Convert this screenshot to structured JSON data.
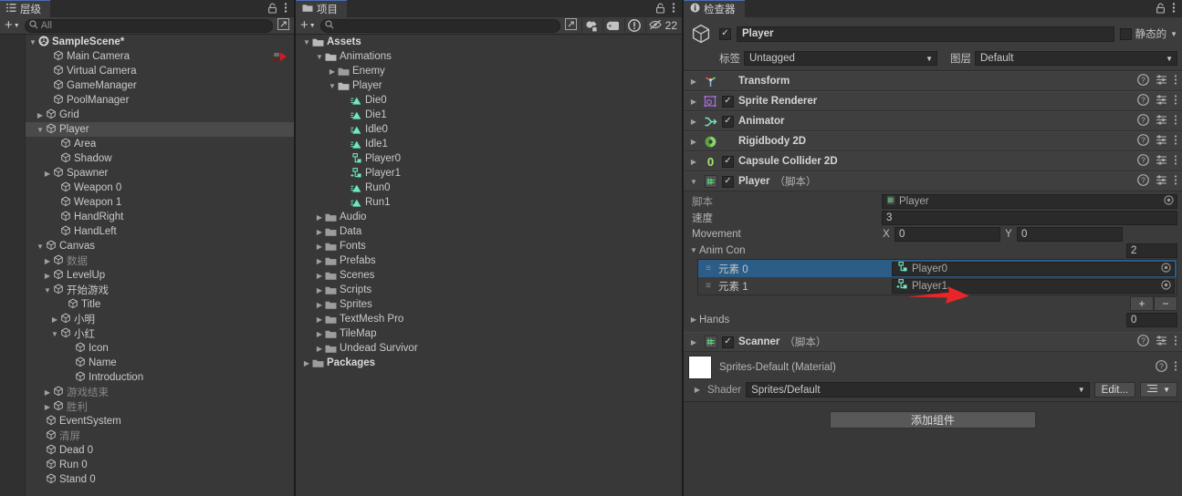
{
  "hierarchy": {
    "tab_label": "层级",
    "lock_icon": "lock-icon",
    "menu_icon": "kebab-menu-icon",
    "add_label": "+",
    "search_placeholder": "All",
    "items": [
      {
        "label": "SampleScene*",
        "depth": 0,
        "arrow": "down",
        "icon": "unity-scene-icon",
        "bold": true,
        "dim": false,
        "selected": false,
        "badge": "camera-preview-icon"
      },
      {
        "label": "Main Camera",
        "depth": 2,
        "arrow": "none",
        "icon": "gameobject-icon",
        "bold": false,
        "dim": false,
        "selected": false,
        "badge": "camera-preview-icon"
      },
      {
        "label": "Virtual Camera",
        "depth": 2,
        "arrow": "none",
        "icon": "gameobject-icon",
        "bold": false,
        "dim": false,
        "selected": false
      },
      {
        "label": "GameManager",
        "depth": 2,
        "arrow": "none",
        "icon": "gameobject-icon",
        "bold": false,
        "dim": false,
        "selected": false
      },
      {
        "label": "PoolManager",
        "depth": 2,
        "arrow": "none",
        "icon": "gameobject-icon",
        "bold": false,
        "dim": false,
        "selected": false
      },
      {
        "label": "Grid",
        "depth": 1,
        "arrow": "right",
        "icon": "gameobject-icon",
        "bold": false,
        "dim": false,
        "selected": false
      },
      {
        "label": "Player",
        "depth": 1,
        "arrow": "down",
        "icon": "gameobject-icon",
        "bold": false,
        "dim": false,
        "selected": true
      },
      {
        "label": "Area",
        "depth": 3,
        "arrow": "none",
        "icon": "gameobject-icon",
        "bold": false,
        "dim": false,
        "selected": false
      },
      {
        "label": "Shadow",
        "depth": 3,
        "arrow": "none",
        "icon": "gameobject-icon",
        "bold": false,
        "dim": false,
        "selected": false
      },
      {
        "label": "Spawner",
        "depth": 2,
        "arrow": "right",
        "icon": "gameobject-icon",
        "bold": false,
        "dim": false,
        "selected": false
      },
      {
        "label": "Weapon 0",
        "depth": 3,
        "arrow": "none",
        "icon": "gameobject-icon",
        "bold": false,
        "dim": false,
        "selected": false
      },
      {
        "label": "Weapon 1",
        "depth": 3,
        "arrow": "none",
        "icon": "gameobject-icon",
        "bold": false,
        "dim": false,
        "selected": false
      },
      {
        "label": "HandRight",
        "depth": 3,
        "arrow": "none",
        "icon": "gameobject-icon",
        "bold": false,
        "dim": false,
        "selected": false
      },
      {
        "label": "HandLeft",
        "depth": 3,
        "arrow": "none",
        "icon": "gameobject-icon",
        "bold": false,
        "dim": false,
        "selected": false
      },
      {
        "label": "Canvas",
        "depth": 1,
        "arrow": "down",
        "icon": "gameobject-icon",
        "bold": false,
        "dim": false,
        "selected": false
      },
      {
        "label": "数据",
        "depth": 2,
        "arrow": "right",
        "icon": "gameobject-icon",
        "bold": false,
        "dim": true,
        "selected": false
      },
      {
        "label": "LevelUp",
        "depth": 2,
        "arrow": "right",
        "icon": "gameobject-icon",
        "bold": false,
        "dim": false,
        "selected": false
      },
      {
        "label": "开始游戏",
        "depth": 2,
        "arrow": "down",
        "icon": "gameobject-icon",
        "bold": false,
        "dim": false,
        "selected": false
      },
      {
        "label": "Title",
        "depth": 4,
        "arrow": "none",
        "icon": "gameobject-icon",
        "bold": false,
        "dim": false,
        "selected": false
      },
      {
        "label": "小明",
        "depth": 3,
        "arrow": "right",
        "icon": "gameobject-icon",
        "bold": false,
        "dim": false,
        "selected": false
      },
      {
        "label": "小红",
        "depth": 3,
        "arrow": "down",
        "icon": "gameobject-icon",
        "bold": false,
        "dim": false,
        "selected": false
      },
      {
        "label": "Icon",
        "depth": 5,
        "arrow": "none",
        "icon": "gameobject-icon",
        "bold": false,
        "dim": false,
        "selected": false
      },
      {
        "label": "Name",
        "depth": 5,
        "arrow": "none",
        "icon": "gameobject-icon",
        "bold": false,
        "dim": false,
        "selected": false
      },
      {
        "label": "Introduction",
        "depth": 5,
        "arrow": "none",
        "icon": "gameobject-icon",
        "bold": false,
        "dim": false,
        "selected": false
      },
      {
        "label": "游戏结束",
        "depth": 2,
        "arrow": "right",
        "icon": "gameobject-icon",
        "bold": false,
        "dim": true,
        "selected": false
      },
      {
        "label": "胜利",
        "depth": 2,
        "arrow": "right",
        "icon": "gameobject-icon",
        "bold": false,
        "dim": true,
        "selected": false
      },
      {
        "label": "EventSystem",
        "depth": 1,
        "arrow": "none",
        "icon": "gameobject-icon",
        "bold": false,
        "dim": false,
        "selected": false
      },
      {
        "label": "清屏",
        "depth": 1,
        "arrow": "none",
        "icon": "gameobject-icon",
        "bold": false,
        "dim": true,
        "selected": false
      },
      {
        "label": "Dead 0",
        "depth": 1,
        "arrow": "none",
        "icon": "gameobject-icon",
        "bold": false,
        "dim": false,
        "selected": false
      },
      {
        "label": "Run 0",
        "depth": 1,
        "arrow": "none",
        "icon": "gameobject-icon",
        "bold": false,
        "dim": false,
        "selected": false
      },
      {
        "label": "Stand 0",
        "depth": 1,
        "arrow": "none",
        "icon": "gameobject-icon",
        "bold": false,
        "dim": false,
        "selected": false
      }
    ]
  },
  "project": {
    "tab_label": "项目",
    "tab_icon": "folder-icon",
    "lock_icon": "lock-icon",
    "menu_icon": "kebab-menu-icon",
    "add_label": "+",
    "search_placeholder": "",
    "toolbar_icons": [
      {
        "name": "search-by-type-icon"
      },
      {
        "name": "search-by-label-icon"
      },
      {
        "name": "warning-icon"
      }
    ],
    "hidden_count": "22",
    "hidden_icon": "eye-off-icon",
    "items": [
      {
        "label": "Assets",
        "depth": 0,
        "arrow": "down",
        "icon": "folder-open-icon",
        "bold": true
      },
      {
        "label": "Animations",
        "depth": 1,
        "arrow": "down",
        "icon": "folder-open-icon",
        "bold": false
      },
      {
        "label": "Enemy",
        "depth": 2,
        "arrow": "right",
        "icon": "folder-icon",
        "bold": false
      },
      {
        "label": "Player",
        "depth": 2,
        "arrow": "down",
        "icon": "folder-open-icon",
        "bold": false
      },
      {
        "label": "Die0",
        "depth": 3,
        "arrow": "none",
        "icon": "animation-clip-icon",
        "bold": false
      },
      {
        "label": "Die1",
        "depth": 3,
        "arrow": "none",
        "icon": "animation-clip-icon",
        "bold": false
      },
      {
        "label": "Idle0",
        "depth": 3,
        "arrow": "none",
        "icon": "animation-clip-icon",
        "bold": false
      },
      {
        "label": "Idle1",
        "depth": 3,
        "arrow": "none",
        "icon": "animation-clip-icon",
        "bold": false
      },
      {
        "label": "Player0",
        "depth": 3,
        "arrow": "none",
        "icon": "animator-controller-icon",
        "bold": false
      },
      {
        "label": "Player1",
        "depth": 3,
        "arrow": "none",
        "icon": "animator-override-icon",
        "bold": false
      },
      {
        "label": "Run0",
        "depth": 3,
        "arrow": "none",
        "icon": "animation-clip-icon",
        "bold": false
      },
      {
        "label": "Run1",
        "depth": 3,
        "arrow": "none",
        "icon": "animation-clip-icon",
        "bold": false
      },
      {
        "label": "Audio",
        "depth": 1,
        "arrow": "right",
        "icon": "folder-icon",
        "bold": false
      },
      {
        "label": "Data",
        "depth": 1,
        "arrow": "right",
        "icon": "folder-icon",
        "bold": false
      },
      {
        "label": "Fonts",
        "depth": 1,
        "arrow": "right",
        "icon": "folder-icon",
        "bold": false
      },
      {
        "label": "Prefabs",
        "depth": 1,
        "arrow": "right",
        "icon": "folder-icon",
        "bold": false
      },
      {
        "label": "Scenes",
        "depth": 1,
        "arrow": "right",
        "icon": "folder-icon",
        "bold": false
      },
      {
        "label": "Scripts",
        "depth": 1,
        "arrow": "right",
        "icon": "folder-icon",
        "bold": false
      },
      {
        "label": "Sprites",
        "depth": 1,
        "arrow": "right",
        "icon": "folder-icon",
        "bold": false
      },
      {
        "label": "TextMesh Pro",
        "depth": 1,
        "arrow": "right",
        "icon": "folder-icon",
        "bold": false
      },
      {
        "label": "TileMap",
        "depth": 1,
        "arrow": "right",
        "icon": "folder-icon",
        "bold": false
      },
      {
        "label": "Undead Survivor",
        "depth": 1,
        "arrow": "right",
        "icon": "folder-icon",
        "bold": false
      },
      {
        "label": "Packages",
        "depth": 0,
        "arrow": "right",
        "icon": "folder-icon",
        "bold": true
      }
    ]
  },
  "inspector": {
    "tab_label": "检查器",
    "tab_icon": "info-icon",
    "lock_icon": "lock-icon",
    "menu_icon": "kebab-menu-icon",
    "object_icon": "gameobject-icon",
    "enabled": true,
    "object_name": "Player",
    "static_label": "静态的",
    "static_checked": false,
    "tag_label": "标签",
    "tag_value": "Untagged",
    "layer_label": "图层",
    "layer_value": "Default",
    "components": [
      {
        "name": "Transform",
        "icon": "transform-icon",
        "has_checkbox": false,
        "checked": false,
        "expanded": false
      },
      {
        "name": "Sprite Renderer",
        "icon": "sprite-renderer-icon",
        "has_checkbox": true,
        "checked": true,
        "expanded": false
      },
      {
        "name": "Animator",
        "icon": "animator-icon",
        "has_checkbox": true,
        "checked": true,
        "expanded": false
      },
      {
        "name": "Rigidbody 2D",
        "icon": "rigidbody2d-icon",
        "has_checkbox": false,
        "checked": false,
        "expanded": false
      },
      {
        "name": "Capsule Collider 2D",
        "icon": "capsule-collider2d-icon",
        "has_checkbox": true,
        "checked": true,
        "expanded": false
      }
    ],
    "player_script": {
      "title": "Player",
      "suffix": "（脚本）",
      "icon": "cs-script-icon",
      "checked": true,
      "expanded": true,
      "script_label": "脚本",
      "script_value": "Player",
      "speed_label": "速度",
      "speed_value": "3",
      "movement_label": "Movement",
      "movement_x_label": "X",
      "movement_x": "0",
      "movement_y_label": "Y",
      "movement_y": "0",
      "anim_con_label": "Anim Con",
      "anim_con_size": "2",
      "anim_con_elements": [
        {
          "label": "元素 0",
          "value": "Player0",
          "selected": true
        },
        {
          "label": "元素 1",
          "value": "Player1",
          "selected": false
        }
      ],
      "add_button": "+",
      "remove_button": "−",
      "hands_label": "Hands",
      "hands_size": "0"
    },
    "scanner_script": {
      "title": "Scanner",
      "suffix": "（脚本）",
      "icon": "cs-script-icon",
      "checked": true,
      "expanded": false
    },
    "material": {
      "name": "Sprites-Default (Material)",
      "swatch_color": "#ffffff",
      "shader_label": "Shader",
      "shader_value": "Sprites/Default",
      "edit_label": "Edit...",
      "preset_icon": "preset-list-icon",
      "help_icon": "help-icon",
      "menu_icon": "kebab-menu-icon"
    },
    "add_component_label": "添加组件"
  },
  "annotation": {
    "type": "red-arrow",
    "color": "#e8262a",
    "direction": "right"
  }
}
